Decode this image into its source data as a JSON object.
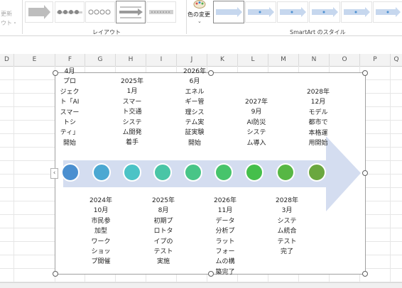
{
  "ribbon": {
    "partial_labels": [
      "更新",
      "ウト・"
    ],
    "layout_group_label": "レイアウト",
    "color_change_label": "色の変更",
    "style_group_label": "SmartArt のスタイル"
  },
  "columns": [
    "D",
    "E",
    "F",
    "G",
    "H",
    "I",
    "J",
    "K",
    "L",
    "M",
    "N",
    "O",
    "P",
    "Q"
  ],
  "diagram": {
    "collapse_glyph": "‹",
    "circle_colors": [
      "#4a8fd0",
      "#4ba8d2",
      "#4bc3c6",
      "#49c5a6",
      "#48c587",
      "#47c46b",
      "#45bf4b",
      "#57b744",
      "#6aa73f"
    ],
    "arrow_color": "#d4ddf0",
    "events_top": [
      {
        "id": "t1",
        "text": "4月\nプロ\nジェク\nト「AI\nスマー\nトシ\nティ」\n開始"
      },
      {
        "id": "t2",
        "text": "2025年\n1月\nスマー\nト交通\nシステ\nム開発\n着手"
      },
      {
        "id": "t3",
        "text": "2026年\n6月\nエネル\nギー管\n理シス\nテム実\n証実験\n開始"
      },
      {
        "id": "t4",
        "text": "2027年\n9月\nAI防災\nシステ\nム導入"
      },
      {
        "id": "t5",
        "text": "2028年\n12月\nモデル\n都市で\n本格運\n用開始"
      }
    ],
    "events_bottom": [
      {
        "id": "b1",
        "text": "2024年\n10月\n市民参\n加型\nワーク\nショッ\nプ開催"
      },
      {
        "id": "b2",
        "text": "2025年\n8月\n初期プ\nロトタ\nイプの\nテスト\n実施"
      },
      {
        "id": "b3",
        "text": "2026年\n11月\nデータ\n分析プ\nラット\nフォー\nムの構\n築完了"
      },
      {
        "id": "b4",
        "text": "2028年\n3月\nシステ\nム統合\nテスト\n完了"
      }
    ]
  }
}
